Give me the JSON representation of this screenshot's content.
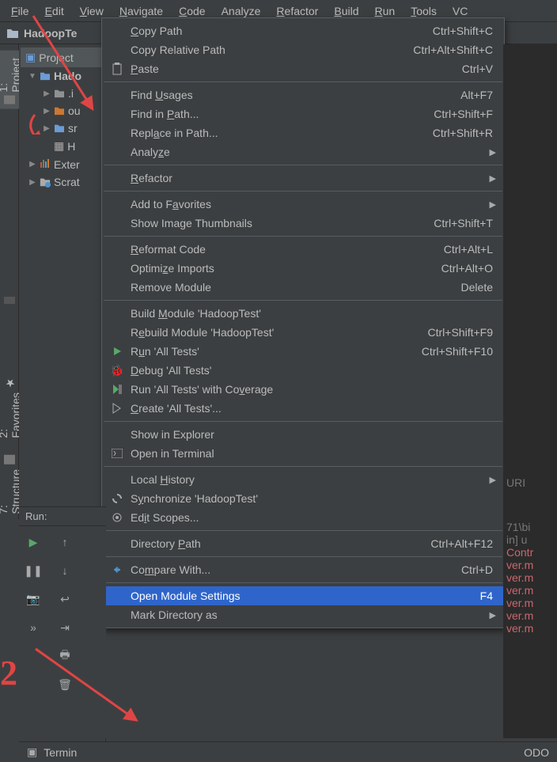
{
  "menubar": [
    {
      "u": "F",
      "rest": "ile"
    },
    {
      "u": "E",
      "rest": "dit"
    },
    {
      "u": "V",
      "rest": "iew"
    },
    {
      "u": "N",
      "rest": "avigate"
    },
    {
      "u": "C",
      "rest": "ode"
    },
    {
      "plain": "Analyze"
    },
    {
      "u": "R",
      "rest": "efactor"
    },
    {
      "u": "B",
      "rest": "uild"
    },
    {
      "u": "R",
      "pre": "",
      "rest": "un"
    },
    {
      "u": "T",
      "rest": "ools"
    },
    {
      "plain": "VC"
    }
  ],
  "breadcrumb": {
    "project": "HadoopTe"
  },
  "left_gutter": [
    {
      "label": "1: Project",
      "active": true
    },
    {
      "label": "2: Favorites"
    },
    {
      "label": "7: Structure"
    }
  ],
  "tree": {
    "tab": "Project",
    "root": "Hado",
    "children": [
      {
        "label": ".i",
        "type": "gray"
      },
      {
        "label": "ou",
        "type": "orange"
      },
      {
        "label": "sr",
        "type": "blue"
      },
      {
        "label": "H",
        "type": "file"
      }
    ],
    "extra": [
      {
        "label": "Exter",
        "icon": "bars"
      },
      {
        "label": "Scrat",
        "icon": "clock"
      }
    ]
  },
  "context_menu": [
    {
      "label": "Copy Path",
      "u": "C",
      "rest": "opy Path",
      "shortcut": "Ctrl+Shift+C"
    },
    {
      "label": "Copy Relative Path",
      "plain": "Copy Relative Path",
      "shortcut": "Ctrl+Alt+Shift+C"
    },
    {
      "label": "Paste",
      "u": "P",
      "rest": "aste",
      "shortcut": "Ctrl+V",
      "icon": "paste"
    },
    {
      "sep": true
    },
    {
      "label": "Find Usages",
      "pre": "Find ",
      "u": "U",
      "rest": "sages",
      "shortcut": "Alt+F7"
    },
    {
      "label": "Find in Path",
      "pre": "Find in ",
      "u": "P",
      "rest": "ath...",
      "shortcut": "Ctrl+Shift+F"
    },
    {
      "label": "Replace in Path",
      "pre": "Repl",
      "u": "a",
      "rest": "ce in Path...",
      "shortcut": "Ctrl+Shift+R"
    },
    {
      "label": "Analyze",
      "pre": "Analy",
      "u": "z",
      "rest": "e",
      "submenu": true
    },
    {
      "sep": true
    },
    {
      "label": "Refactor",
      "u": "R",
      "rest": "efactor",
      "submenu": true
    },
    {
      "sep": true
    },
    {
      "label": "Add to Favorites",
      "pre": "Add to F",
      "u": "a",
      "rest": "vorites",
      "submenu": true
    },
    {
      "label": "Show Image Thumbnails",
      "plain": "Show Image Thumbnails",
      "shortcut": "Ctrl+Shift+T"
    },
    {
      "sep": true
    },
    {
      "label": "Reformat Code",
      "u": "R",
      "rest": "eformat Code",
      "shortcut": "Ctrl+Alt+L"
    },
    {
      "label": "Optimize Imports",
      "pre": "Optimi",
      "u": "z",
      "rest": "e Imports",
      "shortcut": "Ctrl+Alt+O"
    },
    {
      "label": "Remove Module",
      "plain": "Remove Module",
      "shortcut": "Delete"
    },
    {
      "sep": true
    },
    {
      "label": "Build Module",
      "pre": "Build ",
      "u": "M",
      "rest": "odule 'HadoopTest'"
    },
    {
      "label": "Rebuild Module",
      "pre": "R",
      "u": "e",
      "rest": "build Module 'HadoopTest'",
      "shortcut": "Ctrl+Shift+F9"
    },
    {
      "label": "Run All Tests",
      "pre": "R",
      "u": "u",
      "rest": "n 'All Tests'",
      "shortcut": "Ctrl+Shift+F10",
      "icon": "run"
    },
    {
      "label": "Debug All Tests",
      "u": "D",
      "rest": "ebug 'All Tests'",
      "icon": "bug"
    },
    {
      "label": "Run All Tests with Coverage",
      "pre": "Run 'All Tests' with Co",
      "u": "v",
      "rest": "erage",
      "icon": "coverage"
    },
    {
      "label": "Create All Tests",
      "pre": "",
      "u": "C",
      "rest": "reate 'All Tests'...",
      "icon": "test"
    },
    {
      "sep": true
    },
    {
      "label": "Show in Explorer",
      "plain": "Show in Explorer"
    },
    {
      "label": "Open in Terminal",
      "plain": "Open in Terminal",
      "icon": "terminal"
    },
    {
      "sep": true
    },
    {
      "label": "Local History",
      "pre": "Local ",
      "u": "H",
      "rest": "istory",
      "submenu": true
    },
    {
      "label": "Synchronize",
      "pre": "S",
      "u": "y",
      "rest": "nchronize 'HadoopTest'",
      "icon": "sync"
    },
    {
      "label": "Edit Scopes",
      "pre": "Ed",
      "u": "i",
      "rest": "t Scopes...",
      "icon": "scope"
    },
    {
      "sep": true
    },
    {
      "label": "Directory Path",
      "pre": "Directory ",
      "u": "P",
      "rest": "ath",
      "shortcut": "Ctrl+Alt+F12"
    },
    {
      "sep": true
    },
    {
      "label": "Compare With",
      "pre": "Co",
      "u": "m",
      "rest": "pare With...",
      "shortcut": "Ctrl+D",
      "icon": "compare"
    },
    {
      "sep": true
    },
    {
      "label": "Open Module Settings",
      "plain": "Open Module Settings",
      "shortcut": "F4",
      "selected": true
    },
    {
      "label": "Mark Directory as",
      "plain": "Mark Directory as",
      "submenu": true
    }
  ],
  "run_panel": {
    "title": "Run:"
  },
  "editor_lines": [
    "URI",
    "",
    "71\\bi",
    "in] u",
    "Contr",
    "ver.m",
    "ver.m",
    "ver.m",
    "ver.m",
    "ver.m",
    "ver.m"
  ],
  "bottom": {
    "terminal": "Termin",
    "todo": "ODO"
  },
  "annotation": {
    "number": "2"
  }
}
